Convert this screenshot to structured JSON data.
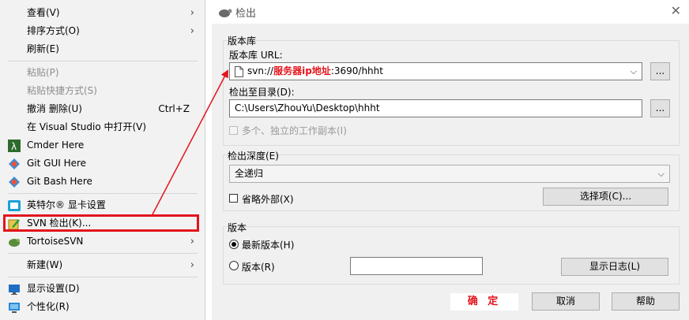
{
  "context_menu": {
    "items": [
      {
        "label": "查看(V)",
        "arrow": "›"
      },
      {
        "label": "排序方式(O)",
        "arrow": "›"
      },
      {
        "label": "刷新(E)"
      },
      {
        "label": "粘贴(P)"
      },
      {
        "label": "粘贴快捷方式(S)"
      },
      {
        "label": "撤消 删除(U)",
        "shortcut": "Ctrl+Z"
      },
      {
        "label": "在 Visual Studio 中打开(V)"
      },
      {
        "label": "Cmder Here"
      },
      {
        "label": "Git GUI Here"
      },
      {
        "label": "Git Bash Here"
      },
      {
        "label": "英特尔® 显卡设置"
      },
      {
        "label": "SVN 检出(K)..."
      },
      {
        "label": "TortoiseSVN",
        "arrow": "›"
      },
      {
        "label": "新建(W)",
        "arrow": "›"
      },
      {
        "label": "显示设置(D)"
      },
      {
        "label": "个性化(R)"
      }
    ]
  },
  "dialog": {
    "title": "检出",
    "close_glyph": "✕",
    "repo_group_label": "版本库",
    "repo_url_label": "版本库 URL:",
    "repo_url_prefix": "svn://",
    "repo_url_highlight": "服务器ip地址",
    "repo_url_suffix": ":3690/hhht",
    "browse_label": "...",
    "checkout_dir_label": "检出至目录(D):",
    "checkout_dir_value": "C:\\Users\\ZhouYu\\Desktop\\hhht",
    "multiple_label": "多个、独立的工作副本(I)",
    "depth_group_label": "检出深度(E)",
    "depth_value": "全递归",
    "omit_externals_label": "省略外部(X)",
    "options_button": "选择项(C)...",
    "revision_group_label": "版本",
    "head_revision_label": "最新版本(H)",
    "revision_label": "版本(R)",
    "revision_value": "",
    "show_log_button": "显示日志(L)",
    "ok_button": "确 定",
    "cancel_button": "取消",
    "help_button": "帮助",
    "dropdown_glyph": "⌵"
  },
  "colors": {
    "annotation_red": "#e3141d",
    "menu_bg": "#f2f2f2",
    "dialog_bg": "#f0f0f0"
  }
}
